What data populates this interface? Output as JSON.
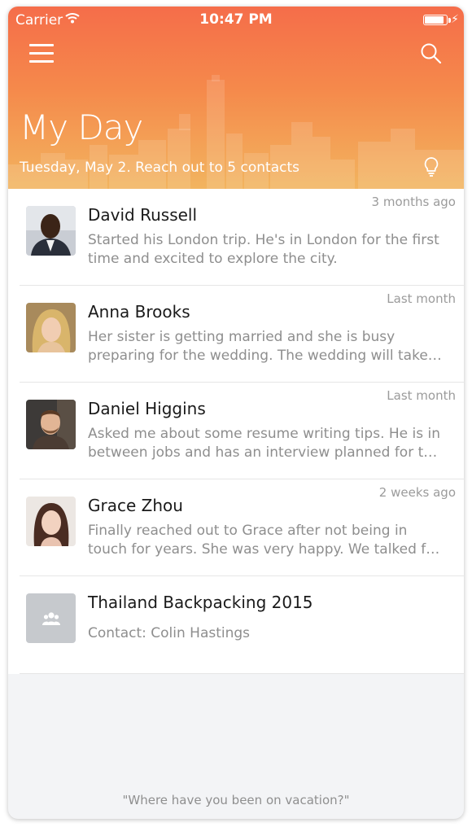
{
  "status_bar": {
    "carrier": "Carrier",
    "time": "10:47 PM",
    "battery_level_percent": 90
  },
  "header": {
    "title": "My Day",
    "subtitle": "Tuesday, May 2. Reach out to 5 contacts",
    "menu_icon": "hamburger-menu-icon",
    "search_icon": "search-icon",
    "tip_icon": "lightbulb-icon"
  },
  "items": [
    {
      "name": "David Russell",
      "time": "3 months ago",
      "note": "Started his London trip. He's in London for the first time and excited to explore the city."
    },
    {
      "name": "Anna Brooks",
      "time": "Last month",
      "note": "Her sister is getting married and she is busy preparing for the wedding. The wedding will take place next month."
    },
    {
      "name": "Daniel Higgins",
      "time": "Last month",
      "note": "Asked me about some resume writing tips. He is in between jobs and has an interview planned for the next week."
    },
    {
      "name": "Grace Zhou",
      "time": "2 weeks ago",
      "note": "Finally reached out to Grace after not being in touch for years. She was very happy. We talked for hours."
    },
    {
      "name": "Thailand Backpacking 2015",
      "contact": "Contact: Colin Hastings",
      "avatar_icon": "group-icon"
    }
  ],
  "footer": {
    "quote": "\"Where have you been on vacation?\""
  },
  "colors": {
    "header_top": "#f56d4a",
    "header_bottom": "#f2b45f",
    "text_primary": "#1a1a1a",
    "text_secondary": "#8e8e8e"
  }
}
